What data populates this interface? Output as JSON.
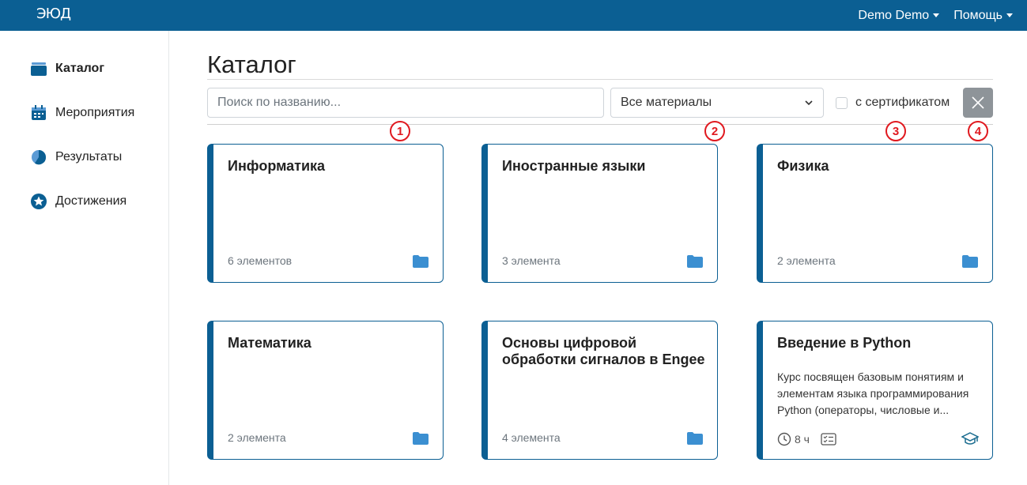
{
  "header": {
    "logo": "ЭЮД",
    "user_menu": "Demo Demo",
    "help_menu": "Помощь"
  },
  "sidebar": {
    "items": [
      {
        "label": "Каталог",
        "icon": "catalog-icon",
        "active": true
      },
      {
        "label": "Мероприятия",
        "icon": "calendar-icon",
        "active": false
      },
      {
        "label": "Результаты",
        "icon": "pie-chart-icon",
        "active": false
      },
      {
        "label": "Достижения",
        "icon": "star-badge-icon",
        "active": false
      }
    ]
  },
  "main": {
    "title": "Каталог",
    "filters": {
      "search_placeholder": "Поиск по названию...",
      "search_value": "",
      "material_select": "Все материалы",
      "certificate_label": "с сертификатом",
      "certificate_checked": false
    },
    "markers": [
      "1",
      "2",
      "3",
      "4"
    ],
    "cards": [
      {
        "title": "Информатика",
        "count": "6 элементов",
        "type": "folder"
      },
      {
        "title": "Иностранные языки",
        "count": "3 элемента",
        "type": "folder"
      },
      {
        "title": "Физика",
        "count": "2 элемента",
        "type": "folder"
      },
      {
        "title": "Математика",
        "count": "2 элемента",
        "type": "folder"
      },
      {
        "title": "Основы цифровой обработки сигналов в Engee",
        "count": "4 элемента",
        "type": "folder"
      },
      {
        "title": "Введение в Python",
        "description": "Курс посвящен базовым понятиям и элементам языка программирования Python (операторы, числовые и...",
        "duration": "8 ч",
        "type": "course"
      }
    ]
  },
  "colors": {
    "primary": "#0b5f93",
    "folder": "#3b8fd1",
    "marker": "#e0191f"
  }
}
